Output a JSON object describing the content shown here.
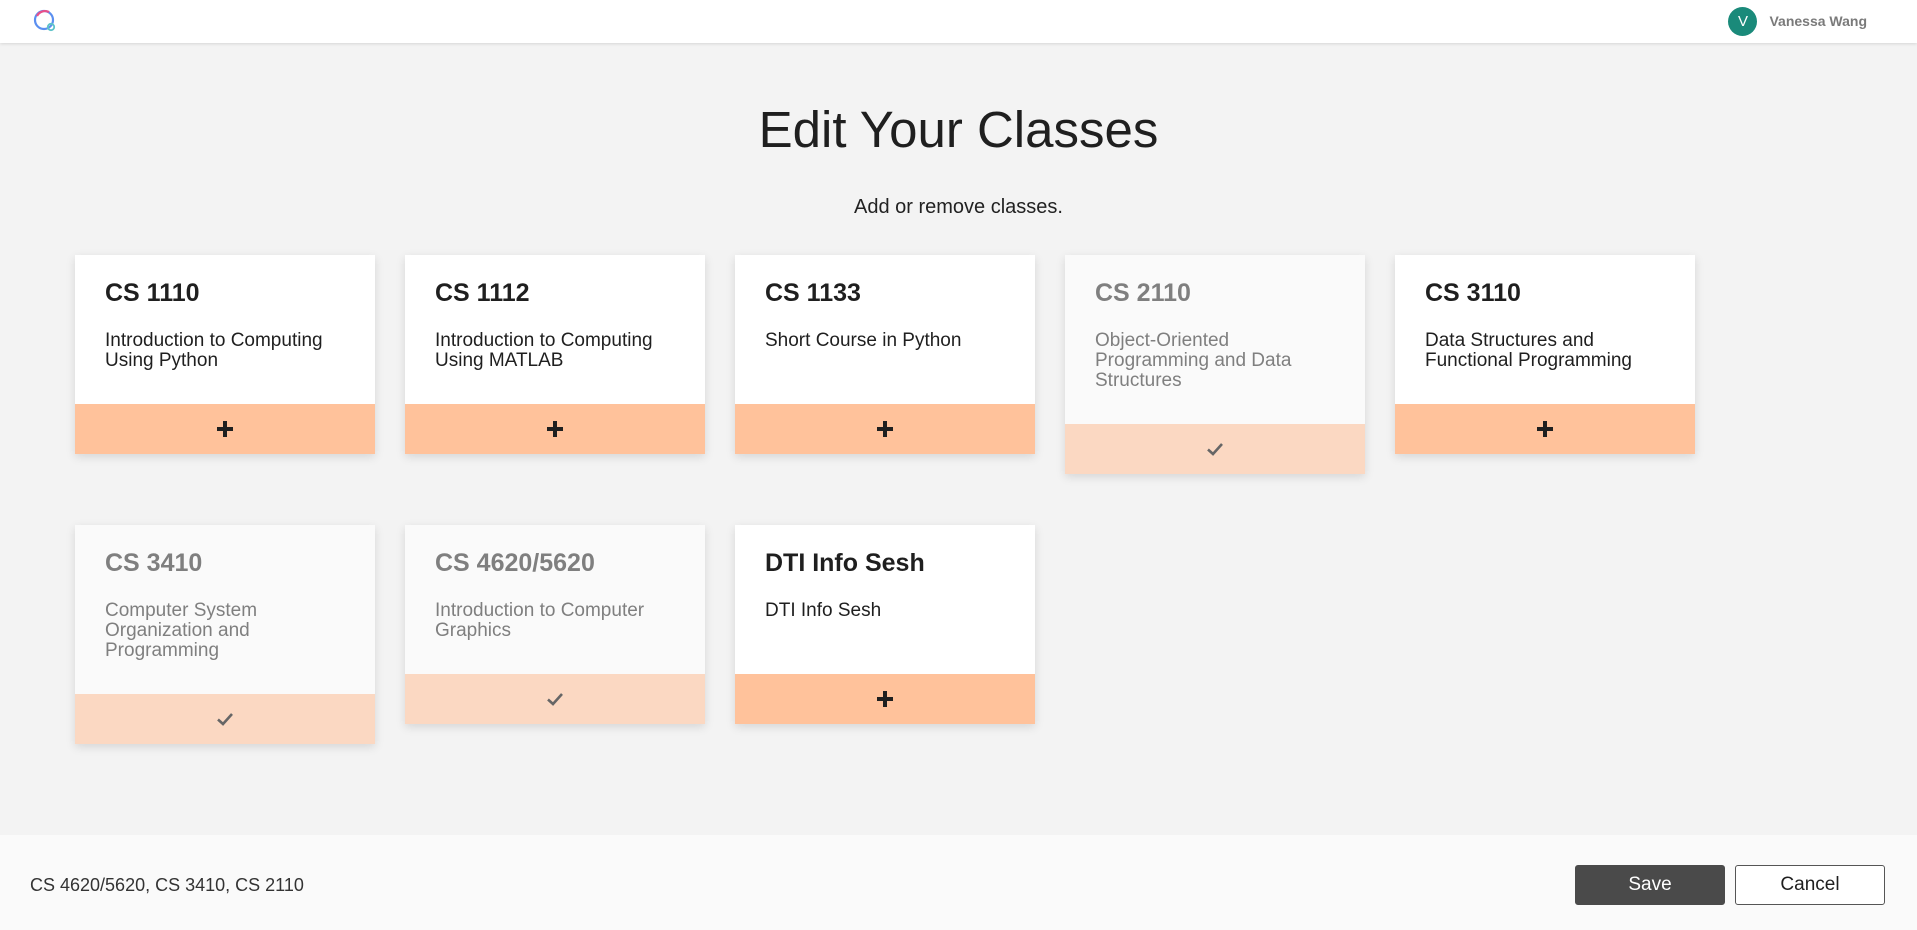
{
  "header": {
    "logo_icon": "app-logo-icon",
    "user": {
      "avatar_initial": "V",
      "name": "Vanessa Wang",
      "avatar_color": "#1a8a7a"
    }
  },
  "main": {
    "title": "Edit Your Classes",
    "subtitle": "Add or remove classes."
  },
  "classes": [
    {
      "code": "CS 1110",
      "name": "Introduction to Computing Using Python",
      "selected": false,
      "action_icon": "plus-icon"
    },
    {
      "code": "CS 1112",
      "name": "Introduction to Computing Using MATLAB",
      "selected": false,
      "action_icon": "plus-icon"
    },
    {
      "code": "CS 1133",
      "name": "Short Course in Python",
      "selected": false,
      "action_icon": "plus-icon"
    },
    {
      "code": "CS 2110",
      "name": "Object-Oriented Programming and Data Structures",
      "selected": true,
      "action_icon": "check-icon"
    },
    {
      "code": "CS 3110",
      "name": "Data Structures and Functional Programming",
      "selected": false,
      "action_icon": "plus-icon"
    },
    {
      "code": "CS 3410",
      "name": "Computer System Organization and Programming",
      "selected": true,
      "action_icon": "check-icon"
    },
    {
      "code": "CS 4620/5620",
      "name": "Introduction to Computer Graphics",
      "selected": true,
      "action_icon": "check-icon"
    },
    {
      "code": "DTI Info Sesh",
      "name": "DTI Info Sesh",
      "selected": false,
      "action_icon": "plus-icon"
    }
  ],
  "footer": {
    "selected_summary": "CS 4620/5620, CS 3410, CS 2110",
    "save_label": "Save",
    "cancel_label": "Cancel"
  },
  "colors": {
    "accent": "#ffc29b",
    "accent_selected": "#fbd8c2",
    "save_button": "#4a4a4a"
  }
}
